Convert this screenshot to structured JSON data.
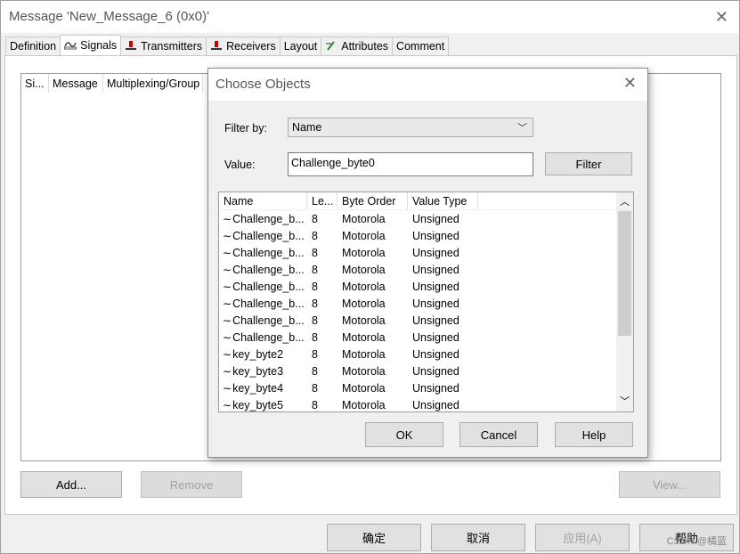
{
  "window": {
    "title": "Message 'New_Message_6 (0x0)'"
  },
  "tabs": [
    {
      "label": "Definition",
      "icon": ""
    },
    {
      "label": "Signals",
      "icon": "signal-icon"
    },
    {
      "label": "Transmitters",
      "icon": "transmitter-icon"
    },
    {
      "label": "Receivers",
      "icon": "receiver-icon"
    },
    {
      "label": "Layout",
      "icon": ""
    },
    {
      "label": "Attributes",
      "icon": "attribute-icon"
    },
    {
      "label": "Comment",
      "icon": ""
    }
  ],
  "signals_grid": {
    "columns": [
      "Si...",
      "Message",
      "Multiplexing/Group"
    ]
  },
  "panel_buttons": {
    "add": "Add...",
    "remove": "Remove",
    "view": "View..."
  },
  "dialog": {
    "title": "Choose Objects",
    "filter_by_label": "Filter by:",
    "filter_by_value": "Name",
    "value_label": "Value:",
    "value_input": "Challenge_byte0",
    "filter_button": "Filter",
    "list": {
      "columns": [
        "Name",
        "Le...",
        "Byte Order",
        "Value Type"
      ],
      "rows": [
        [
          "Challenge_b...",
          "8",
          "Motorola",
          "Unsigned"
        ],
        [
          "Challenge_b...",
          "8",
          "Motorola",
          "Unsigned"
        ],
        [
          "Challenge_b...",
          "8",
          "Motorola",
          "Unsigned"
        ],
        [
          "Challenge_b...",
          "8",
          "Motorola",
          "Unsigned"
        ],
        [
          "Challenge_b...",
          "8",
          "Motorola",
          "Unsigned"
        ],
        [
          "Challenge_b...",
          "8",
          "Motorola",
          "Unsigned"
        ],
        [
          "Challenge_b...",
          "8",
          "Motorola",
          "Unsigned"
        ],
        [
          "Challenge_b...",
          "8",
          "Motorola",
          "Unsigned"
        ],
        [
          "key_byte2",
          "8",
          "Motorola",
          "Unsigned"
        ],
        [
          "key_byte3",
          "8",
          "Motorola",
          "Unsigned"
        ],
        [
          "key_byte4",
          "8",
          "Motorola",
          "Unsigned"
        ],
        [
          "key_byte5",
          "8",
          "Motorola",
          "Unsigned"
        ]
      ]
    },
    "ok": "OK",
    "cancel": "Cancel",
    "help": "Help"
  },
  "footer": {
    "ok": "确定",
    "cancel": "取消",
    "apply": "应用(A)",
    "help": "帮助"
  },
  "watermark": "CSDN @橘蓝"
}
